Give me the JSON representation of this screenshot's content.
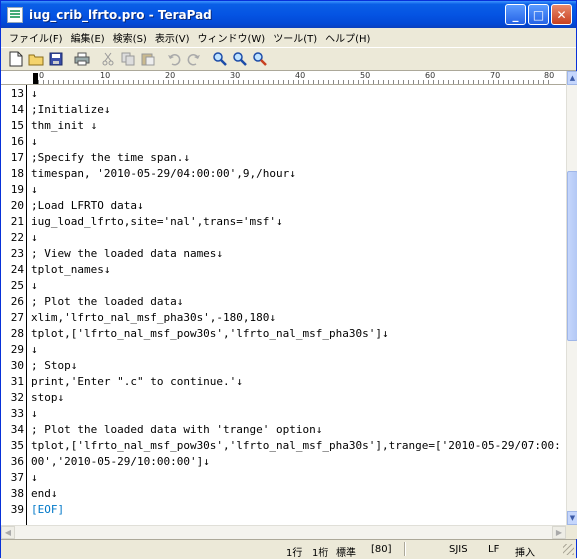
{
  "window": {
    "title": "iug_crib_lfrto.pro - TeraPad"
  },
  "title_buttons": {
    "minimize": "_",
    "maximize": "□",
    "close": "✕"
  },
  "menu": [
    "ファイル(F)",
    "編集(E)",
    "検索(S)",
    "表示(V)",
    "ウィンドウ(W)",
    "ツール(T)",
    "ヘルプ(H)"
  ],
  "toolbar": [
    "new-file-icon",
    "open-folder-icon",
    "save-icon",
    "print-icon",
    "cut-icon",
    "copy-icon",
    "paste-icon",
    "undo-icon",
    "redo-icon",
    "find-icon",
    "find-next-icon",
    "find-prev-icon"
  ],
  "ruler": {
    "labels": [
      "0",
      "10",
      "20",
      "30",
      "40",
      "50",
      "60",
      "70",
      "80"
    ]
  },
  "lines": [
    {
      "n": "13",
      "t": "↓"
    },
    {
      "n": "14",
      "t": ";Initialize↓"
    },
    {
      "n": "15",
      "t": "thm_init ↓"
    },
    {
      "n": "16",
      "t": "↓"
    },
    {
      "n": "17",
      "t": ";Specify the time span.↓"
    },
    {
      "n": "18",
      "t": "timespan, '2010-05-29/04:00:00',9,/hour↓"
    },
    {
      "n": "19",
      "t": "↓"
    },
    {
      "n": "20",
      "t": ";Load LFRTO data↓"
    },
    {
      "n": "21",
      "t": "iug_load_lfrto,site='nal',trans='msf'↓"
    },
    {
      "n": "22",
      "t": "↓"
    },
    {
      "n": "23",
      "t": "; View the loaded data names↓"
    },
    {
      "n": "24",
      "t": "tplot_names↓"
    },
    {
      "n": "25",
      "t": "↓"
    },
    {
      "n": "26",
      "t": "; Plot the loaded data↓"
    },
    {
      "n": "27",
      "t": "xlim,'lfrto_nal_msf_pha30s',-180,180↓"
    },
    {
      "n": "28",
      "t": "tplot,['lfrto_nal_msf_pow30s','lfrto_nal_msf_pha30s']↓"
    },
    {
      "n": "29",
      "t": "↓"
    },
    {
      "n": "30",
      "t": "; Stop↓"
    },
    {
      "n": "31",
      "t": "print,'Enter \".c\" to continue.'↓"
    },
    {
      "n": "32",
      "t": "stop↓"
    },
    {
      "n": "33",
      "t": "↓"
    },
    {
      "n": "34",
      "t": "; Plot the loaded data with 'trange' option↓"
    },
    {
      "n": "35",
      "t": "tplot,['lfrto_nal_msf_pow30s','lfrto_nal_msf_pha30s'],trange=['2010-05-29/07:00:"
    },
    {
      "n": "36",
      "t": "00','2010-05-29/10:00:00']↓"
    },
    {
      "n": "37",
      "t": "↓"
    },
    {
      "n": "38",
      "t": "end↓"
    },
    {
      "n": "39",
      "t": "[EOF]"
    }
  ],
  "status": {
    "line": "1行",
    "col": "1桁",
    "mode": "標準",
    "code": "[80]",
    "encoding": "SJIS",
    "newline": "LF",
    "insert": "挿入"
  },
  "colors": {
    "eof": "#0078c8",
    "titlebar": "#0554e3"
  }
}
